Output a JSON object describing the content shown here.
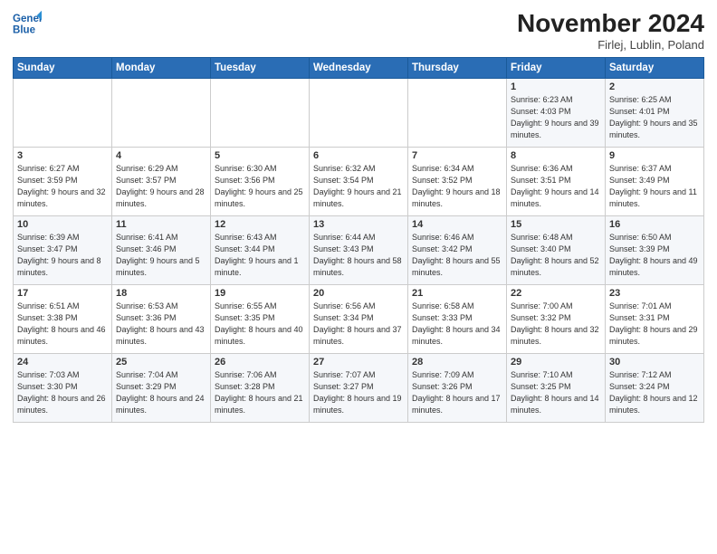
{
  "logo": {
    "line1": "General",
    "line2": "Blue"
  },
  "title": "November 2024",
  "subtitle": "Firlej, Lublin, Poland",
  "days_of_week": [
    "Sunday",
    "Monday",
    "Tuesday",
    "Wednesday",
    "Thursday",
    "Friday",
    "Saturday"
  ],
  "weeks": [
    [
      {
        "day": "",
        "info": ""
      },
      {
        "day": "",
        "info": ""
      },
      {
        "day": "",
        "info": ""
      },
      {
        "day": "",
        "info": ""
      },
      {
        "day": "",
        "info": ""
      },
      {
        "day": "1",
        "info": "Sunrise: 6:23 AM\nSunset: 4:03 PM\nDaylight: 9 hours\nand 39 minutes."
      },
      {
        "day": "2",
        "info": "Sunrise: 6:25 AM\nSunset: 4:01 PM\nDaylight: 9 hours\nand 35 minutes."
      }
    ],
    [
      {
        "day": "3",
        "info": "Sunrise: 6:27 AM\nSunset: 3:59 PM\nDaylight: 9 hours\nand 32 minutes."
      },
      {
        "day": "4",
        "info": "Sunrise: 6:29 AM\nSunset: 3:57 PM\nDaylight: 9 hours\nand 28 minutes."
      },
      {
        "day": "5",
        "info": "Sunrise: 6:30 AM\nSunset: 3:56 PM\nDaylight: 9 hours\nand 25 minutes."
      },
      {
        "day": "6",
        "info": "Sunrise: 6:32 AM\nSunset: 3:54 PM\nDaylight: 9 hours\nand 21 minutes."
      },
      {
        "day": "7",
        "info": "Sunrise: 6:34 AM\nSunset: 3:52 PM\nDaylight: 9 hours\nand 18 minutes."
      },
      {
        "day": "8",
        "info": "Sunrise: 6:36 AM\nSunset: 3:51 PM\nDaylight: 9 hours\nand 14 minutes."
      },
      {
        "day": "9",
        "info": "Sunrise: 6:37 AM\nSunset: 3:49 PM\nDaylight: 9 hours\nand 11 minutes."
      }
    ],
    [
      {
        "day": "10",
        "info": "Sunrise: 6:39 AM\nSunset: 3:47 PM\nDaylight: 9 hours\nand 8 minutes."
      },
      {
        "day": "11",
        "info": "Sunrise: 6:41 AM\nSunset: 3:46 PM\nDaylight: 9 hours\nand 5 minutes."
      },
      {
        "day": "12",
        "info": "Sunrise: 6:43 AM\nSunset: 3:44 PM\nDaylight: 9 hours\nand 1 minute."
      },
      {
        "day": "13",
        "info": "Sunrise: 6:44 AM\nSunset: 3:43 PM\nDaylight: 8 hours\nand 58 minutes."
      },
      {
        "day": "14",
        "info": "Sunrise: 6:46 AM\nSunset: 3:42 PM\nDaylight: 8 hours\nand 55 minutes."
      },
      {
        "day": "15",
        "info": "Sunrise: 6:48 AM\nSunset: 3:40 PM\nDaylight: 8 hours\nand 52 minutes."
      },
      {
        "day": "16",
        "info": "Sunrise: 6:50 AM\nSunset: 3:39 PM\nDaylight: 8 hours\nand 49 minutes."
      }
    ],
    [
      {
        "day": "17",
        "info": "Sunrise: 6:51 AM\nSunset: 3:38 PM\nDaylight: 8 hours\nand 46 minutes."
      },
      {
        "day": "18",
        "info": "Sunrise: 6:53 AM\nSunset: 3:36 PM\nDaylight: 8 hours\nand 43 minutes."
      },
      {
        "day": "19",
        "info": "Sunrise: 6:55 AM\nSunset: 3:35 PM\nDaylight: 8 hours\nand 40 minutes."
      },
      {
        "day": "20",
        "info": "Sunrise: 6:56 AM\nSunset: 3:34 PM\nDaylight: 8 hours\nand 37 minutes."
      },
      {
        "day": "21",
        "info": "Sunrise: 6:58 AM\nSunset: 3:33 PM\nDaylight: 8 hours\nand 34 minutes."
      },
      {
        "day": "22",
        "info": "Sunrise: 7:00 AM\nSunset: 3:32 PM\nDaylight: 8 hours\nand 32 minutes."
      },
      {
        "day": "23",
        "info": "Sunrise: 7:01 AM\nSunset: 3:31 PM\nDaylight: 8 hours\nand 29 minutes."
      }
    ],
    [
      {
        "day": "24",
        "info": "Sunrise: 7:03 AM\nSunset: 3:30 PM\nDaylight: 8 hours\nand 26 minutes."
      },
      {
        "day": "25",
        "info": "Sunrise: 7:04 AM\nSunset: 3:29 PM\nDaylight: 8 hours\nand 24 minutes."
      },
      {
        "day": "26",
        "info": "Sunrise: 7:06 AM\nSunset: 3:28 PM\nDaylight: 8 hours\nand 21 minutes."
      },
      {
        "day": "27",
        "info": "Sunrise: 7:07 AM\nSunset: 3:27 PM\nDaylight: 8 hours\nand 19 minutes."
      },
      {
        "day": "28",
        "info": "Sunrise: 7:09 AM\nSunset: 3:26 PM\nDaylight: 8 hours\nand 17 minutes."
      },
      {
        "day": "29",
        "info": "Sunrise: 7:10 AM\nSunset: 3:25 PM\nDaylight: 8 hours\nand 14 minutes."
      },
      {
        "day": "30",
        "info": "Sunrise: 7:12 AM\nSunset: 3:24 PM\nDaylight: 8 hours\nand 12 minutes."
      }
    ]
  ]
}
